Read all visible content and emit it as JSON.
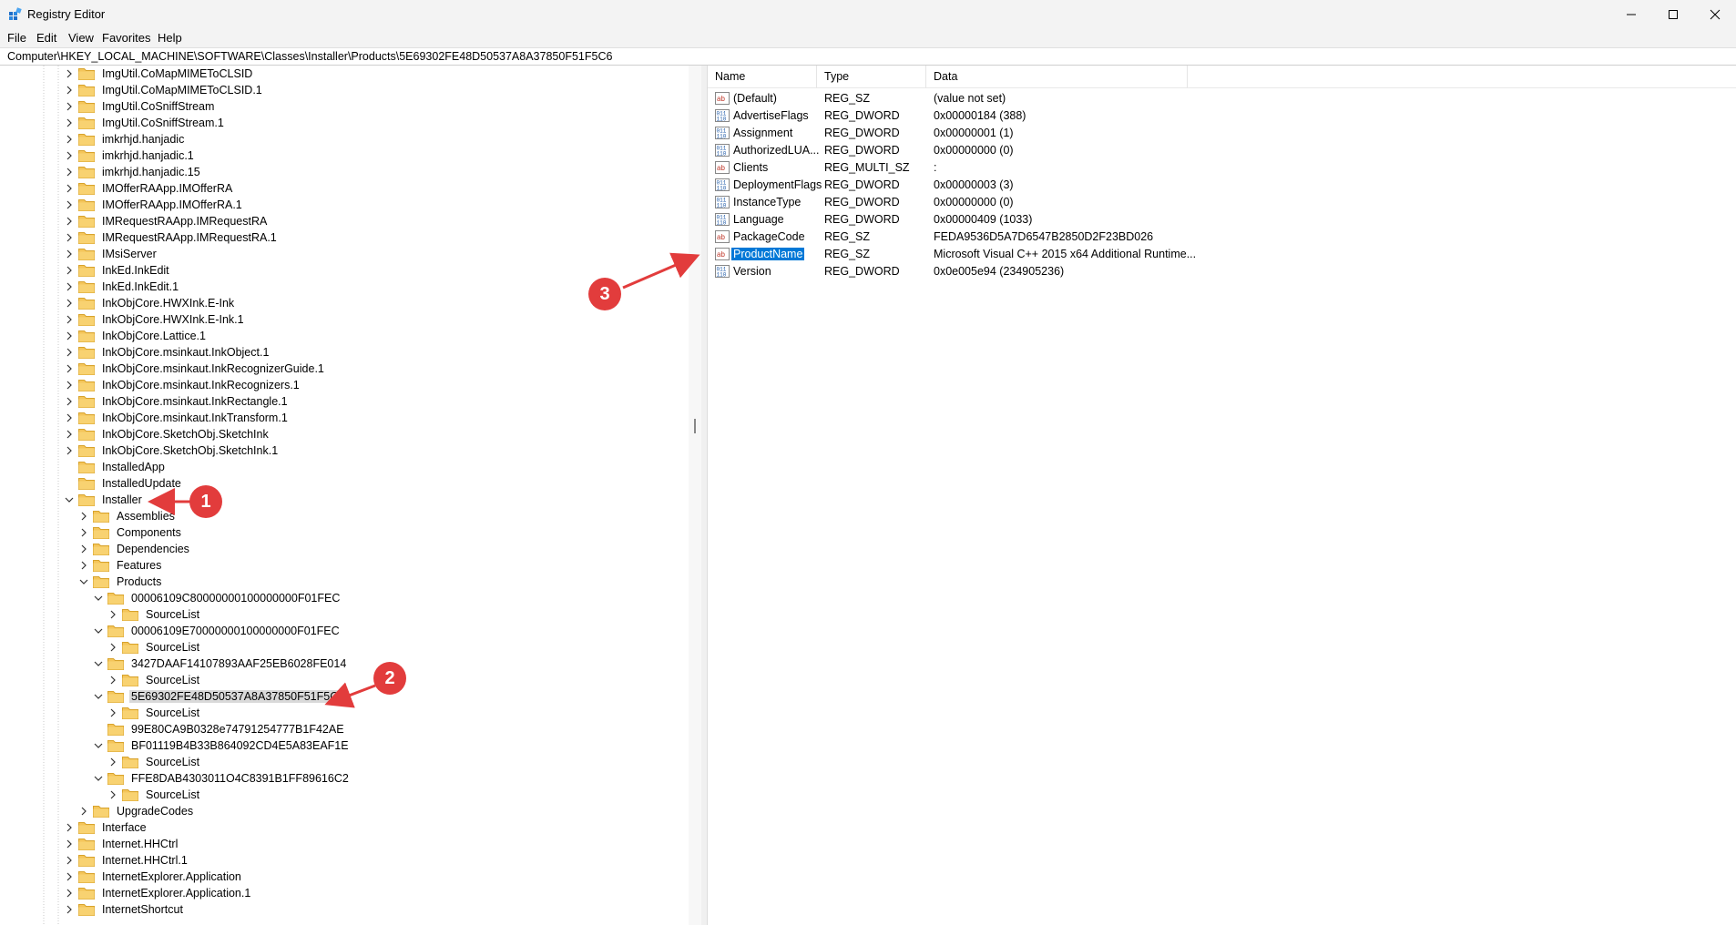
{
  "window": {
    "title": "Registry Editor",
    "minimize_icon": "minimize-icon",
    "maximize_icon": "maximize-icon",
    "close_icon": "close-icon"
  },
  "menu": [
    "File",
    "Edit",
    "View",
    "Favorites",
    "Help"
  ],
  "address": "Computer\\HKEY_LOCAL_MACHINE\\SOFTWARE\\Classes\\Installer\\Products\\5E69302FE48D50537A8A37850F51F5C6",
  "tree": [
    {
      "label": "ImgUtil.CoMapMIMEToCLSID",
      "level": 0,
      "state": "collapsed"
    },
    {
      "label": "ImgUtil.CoMapMIMEToCLSID.1",
      "level": 0,
      "state": "collapsed"
    },
    {
      "label": "ImgUtil.CoSniffStream",
      "level": 0,
      "state": "collapsed"
    },
    {
      "label": "ImgUtil.CoSniffStream.1",
      "level": 0,
      "state": "collapsed"
    },
    {
      "label": "imkrhjd.hanjadic",
      "level": 0,
      "state": "collapsed"
    },
    {
      "label": "imkrhjd.hanjadic.1",
      "level": 0,
      "state": "collapsed"
    },
    {
      "label": "imkrhjd.hanjadic.15",
      "level": 0,
      "state": "collapsed"
    },
    {
      "label": "IMOfferRAApp.IMOfferRA",
      "level": 0,
      "state": "collapsed"
    },
    {
      "label": "IMOfferRAApp.IMOfferRA.1",
      "level": 0,
      "state": "collapsed"
    },
    {
      "label": "IMRequestRAApp.IMRequestRA",
      "level": 0,
      "state": "collapsed"
    },
    {
      "label": "IMRequestRAApp.IMRequestRA.1",
      "level": 0,
      "state": "collapsed"
    },
    {
      "label": "IMsiServer",
      "level": 0,
      "state": "collapsed"
    },
    {
      "label": "InkEd.InkEdit",
      "level": 0,
      "state": "collapsed"
    },
    {
      "label": "InkEd.InkEdit.1",
      "level": 0,
      "state": "collapsed"
    },
    {
      "label": "InkObjCore.HWXInk.E-Ink",
      "level": 0,
      "state": "collapsed"
    },
    {
      "label": "InkObjCore.HWXInk.E-Ink.1",
      "level": 0,
      "state": "collapsed"
    },
    {
      "label": "InkObjCore.Lattice.1",
      "level": 0,
      "state": "collapsed"
    },
    {
      "label": "InkObjCore.msinkaut.InkObject.1",
      "level": 0,
      "state": "collapsed"
    },
    {
      "label": "InkObjCore.msinkaut.InkRecognizerGuide.1",
      "level": 0,
      "state": "collapsed"
    },
    {
      "label": "InkObjCore.msinkaut.InkRecognizers.1",
      "level": 0,
      "state": "collapsed"
    },
    {
      "label": "InkObjCore.msinkaut.InkRectangle.1",
      "level": 0,
      "state": "collapsed"
    },
    {
      "label": "InkObjCore.msinkaut.InkTransform.1",
      "level": 0,
      "state": "collapsed"
    },
    {
      "label": "InkObjCore.SketchObj.SketchInk",
      "level": 0,
      "state": "collapsed"
    },
    {
      "label": "InkObjCore.SketchObj.SketchInk.1",
      "level": 0,
      "state": "collapsed"
    },
    {
      "label": "InstalledApp",
      "level": 0,
      "state": "leaf"
    },
    {
      "label": "InstalledUpdate",
      "level": 0,
      "state": "leaf"
    },
    {
      "label": "Installer",
      "level": 0,
      "state": "expanded"
    },
    {
      "label": "Assemblies",
      "level": 1,
      "state": "collapsed"
    },
    {
      "label": "Components",
      "level": 1,
      "state": "collapsed"
    },
    {
      "label": "Dependencies",
      "level": 1,
      "state": "collapsed"
    },
    {
      "label": "Features",
      "level": 1,
      "state": "collapsed"
    },
    {
      "label": "Products",
      "level": 1,
      "state": "expanded"
    },
    {
      "label": "00006109C80000000100000000F01FEC",
      "level": 2,
      "state": "expanded"
    },
    {
      "label": "SourceList",
      "level": 3,
      "state": "collapsed"
    },
    {
      "label": "00006109E70000000100000000F01FEC",
      "level": 2,
      "state": "expanded"
    },
    {
      "label": "SourceList",
      "level": 3,
      "state": "collapsed"
    },
    {
      "label": "3427DAAF14107893AAF25EB6028FE014",
      "level": 2,
      "state": "expanded"
    },
    {
      "label": "SourceList",
      "level": 3,
      "state": "collapsed"
    },
    {
      "label": "5E69302FE48D50537A8A37850F51F5C6",
      "level": 2,
      "state": "expanded",
      "selected": true
    },
    {
      "label": "SourceList",
      "level": 3,
      "state": "collapsed"
    },
    {
      "label": "99E80CA9B0328e74791254777B1F42AE",
      "level": 2,
      "state": "leaf"
    },
    {
      "label": "BF01119B4B33B864092CD4E5A83EAF1E",
      "level": 2,
      "state": "expanded"
    },
    {
      "label": "SourceList",
      "level": 3,
      "state": "collapsed"
    },
    {
      "label": "FFE8DAB4303011O4C8391B1FF89616C2",
      "level": 2,
      "state": "expanded"
    },
    {
      "label": "SourceList",
      "level": 3,
      "state": "collapsed"
    },
    {
      "label": "UpgradeCodes",
      "level": 1,
      "state": "collapsed"
    },
    {
      "label": "Interface",
      "level": 0,
      "state": "collapsed"
    },
    {
      "label": "Internet.HHCtrl",
      "level": 0,
      "state": "collapsed"
    },
    {
      "label": "Internet.HHCtrl.1",
      "level": 0,
      "state": "collapsed"
    },
    {
      "label": "InternetExplorer.Application",
      "level": 0,
      "state": "collapsed"
    },
    {
      "label": "InternetExplorer.Application.1",
      "level": 0,
      "state": "collapsed"
    },
    {
      "label": "InternetShortcut",
      "level": 0,
      "state": "collapsed"
    }
  ],
  "list": {
    "headers": [
      "Name",
      "Type",
      "Data"
    ],
    "rows": [
      {
        "icon": "string-value-icon",
        "name": "(Default)",
        "type": "REG_SZ",
        "data": "(value not set)"
      },
      {
        "icon": "binary-value-icon",
        "name": "AdvertiseFlags",
        "type": "REG_DWORD",
        "data": "0x00000184 (388)"
      },
      {
        "icon": "binary-value-icon",
        "name": "Assignment",
        "type": "REG_DWORD",
        "data": "0x00000001 (1)"
      },
      {
        "icon": "binary-value-icon",
        "name": "AuthorizedLUA...",
        "type": "REG_DWORD",
        "data": "0x00000000 (0)"
      },
      {
        "icon": "string-value-icon",
        "name": "Clients",
        "type": "REG_MULTI_SZ",
        "data": ":"
      },
      {
        "icon": "binary-value-icon",
        "name": "DeploymentFlags",
        "type": "REG_DWORD",
        "data": "0x00000003 (3)"
      },
      {
        "icon": "binary-value-icon",
        "name": "InstanceType",
        "type": "REG_DWORD",
        "data": "0x00000000 (0)"
      },
      {
        "icon": "binary-value-icon",
        "name": "Language",
        "type": "REG_DWORD",
        "data": "0x00000409 (1033)"
      },
      {
        "icon": "string-value-icon",
        "name": "PackageCode",
        "type": "REG_SZ",
        "data": "FEDA9536D5A7D6547B2850D2F23BD026"
      },
      {
        "icon": "string-value-icon",
        "name": "ProductName",
        "type": "REG_SZ",
        "data": "Microsoft Visual C++ 2015 x64 Additional Runtime...",
        "selected": true
      },
      {
        "icon": "binary-value-icon",
        "name": "Version",
        "type": "REG_DWORD",
        "data": "0x0e005e94 (234905236)"
      }
    ]
  },
  "callouts": [
    "1",
    "2",
    "3"
  ],
  "colors": {
    "accent": "#0078d7",
    "folder": "#f4c55a",
    "callout": "#e23c3c"
  }
}
